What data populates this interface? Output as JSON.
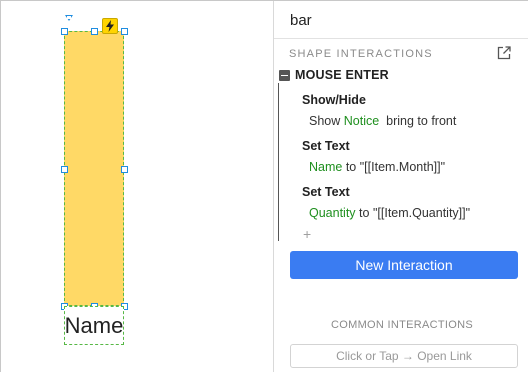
{
  "canvas": {
    "shape_label": "Name",
    "colors": {
      "bar_fill": "#ffd966",
      "selection": "#57b846",
      "handles": "#1f8de0",
      "interaction_badge": "#ffd400"
    },
    "icons": {
      "interaction_badge": "lightning-icon",
      "rotate": "rotate-handle-icon"
    }
  },
  "panel": {
    "title": "bar",
    "section_label": "SHAPE INTERACTIONS",
    "popout_icon": "popout-icon",
    "event": {
      "name": "MOUSE ENTER",
      "actions": [
        {
          "title": "Show/Hide",
          "parts": [
            "Show",
            "Notice",
            "bring to front"
          ]
        },
        {
          "title": "Set Text",
          "parts": [
            "Name",
            "to",
            "\"[[Item.Month]]\""
          ]
        },
        {
          "title": "Set Text",
          "parts": [
            "Quantity",
            "to",
            "\"[[Item.Quantity]]\""
          ]
        }
      ],
      "add_symbol": "+"
    },
    "new_interaction_label": "New Interaction",
    "common_label": "COMMON INTERACTIONS",
    "common_item": "Click or Tap → Open Link",
    "colors": {
      "primary_button": "#3a7cf2",
      "target_text": "#1e8f1e"
    }
  }
}
